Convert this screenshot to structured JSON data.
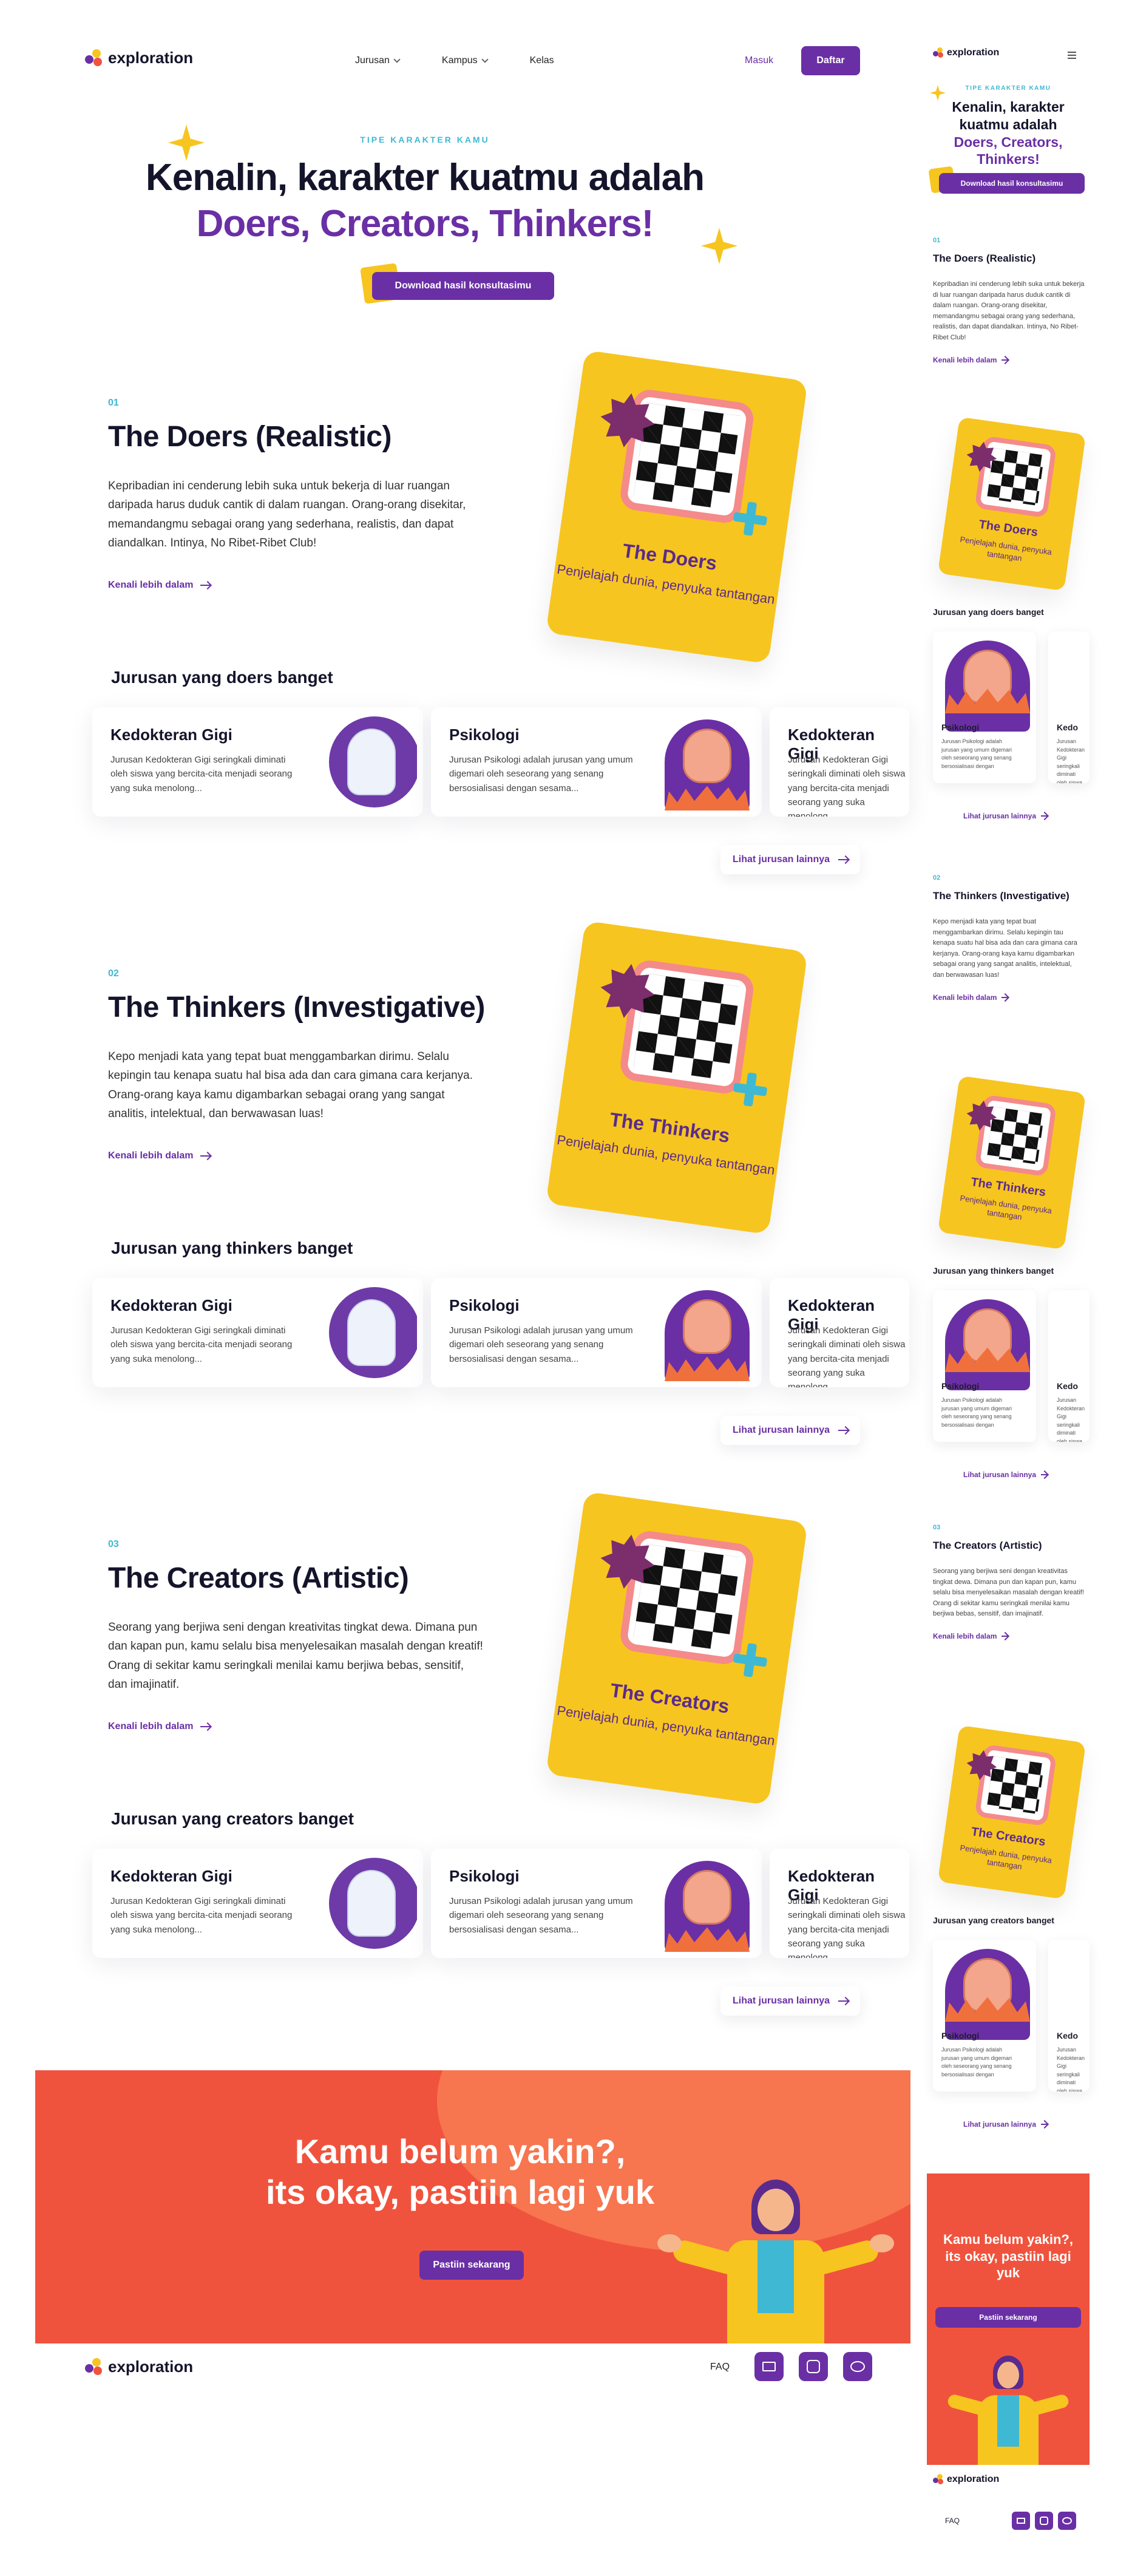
{
  "brand": {
    "name": "exploration"
  },
  "nav": {
    "items": [
      "Jurusan",
      "Kampus",
      "Kelas"
    ],
    "login": "Masuk",
    "register": "Daftar"
  },
  "hero": {
    "eyebrow": "TIPE KARAKTER KAMU",
    "title_line1": "Kenalin, karakter kuatmu adalah",
    "title_line2": "Doers, Creators, Thinkers!",
    "download": "Download hasil konsultasimu"
  },
  "sections": [
    {
      "num": "01",
      "title": "The Doers (Realistic)",
      "desc": "Kepribadian ini cenderung lebih suka untuk bekerja di luar ruangan daripada harus duduk cantik di dalam ruangan. Orang-orang disekitar, memandangmu sebagai orang yang sederhana, realistis, dan dapat diandalkan. Intinya, No Ribet-Ribet Club!",
      "link": "Kenali lebih dalam",
      "card_title": "The Doers",
      "card_sub": "Penjelajah dunia, penyuka tantangan",
      "majors_title": "Jurusan yang doers banget"
    },
    {
      "num": "02",
      "title": "The Thinkers (Investigative)",
      "desc": "Kepo menjadi kata yang tepat buat menggambarkan dirimu. Selalu kepingin tau kenapa suatu hal bisa ada dan cara gimana cara kerjanya. Orang-orang kaya kamu digambarkan sebagai orang yang sangat analitis, intelektual, dan berwawasan luas!",
      "link": "Kenali lebih dalam",
      "card_title": "The Thinkers",
      "card_sub": "Penjelajah dunia, penyuka tantangan",
      "majors_title": "Jurusan yang thinkers banget"
    },
    {
      "num": "03",
      "title": "The Creators (Artistic)",
      "desc": "Seorang yang berjiwa seni dengan kreativitas tingkat dewa. Dimana pun dan kapan pun, kamu selalu bisa menyelesaikan masalah dengan kreatif!  Orang di sekitar kamu seringkali menilai kamu berjiwa bebas, sensitif, dan imajinatif.",
      "link": "Kenali lebih dalam",
      "card_title": "The Creators",
      "card_sub": "Penjelajah dunia, penyuka tantangan",
      "majors_title": "Jurusan yang creators banget"
    }
  ],
  "majors": [
    {
      "name": "Kedokteran Gigi",
      "desc": "Jurusan Kedokteran Gigi seringkali diminati oleh siswa yang bercita-cita menjadi seorang yang suka menolong..."
    },
    {
      "name": "Psikologi",
      "desc": "Jurusan Psikologi adalah jurusan yang umum digemari oleh seseorang yang senang bersosialisasi dengan sesama..."
    },
    {
      "name": "Kedokteran Gigi",
      "desc": "Jurusan Kedokteran Gigi seringkali diminati oleh siswa yang bercita-cita menjadi seorang yang suka menolong..."
    }
  ],
  "mobile_majors": [
    {
      "name": "Psikologi",
      "desc": "Jurusan Psikologi adalah jurusan yang umum digemari oleh seseorang yang senang bersosialisasi dengan"
    },
    {
      "name": "Kedo",
      "desc": "Jurusan Kedokteran Gigi seringkali diminati oleh siswa yang"
    }
  ],
  "see_more": "Lihat jurusan lainnya",
  "cta": {
    "line1": "Kamu belum yakin?,",
    "line2": "its okay, pastiin lagi yuk",
    "mobile_title": "Kamu belum yakin?, its okay, pastiin lagi yuk",
    "button": "Pastiin sekarang"
  },
  "footer": {
    "faq": "FAQ"
  },
  "colors": {
    "primary": "#6a2fa5",
    "accent": "#3fb8d4",
    "yellow": "#f7c51f",
    "cta": "#f0533d"
  }
}
